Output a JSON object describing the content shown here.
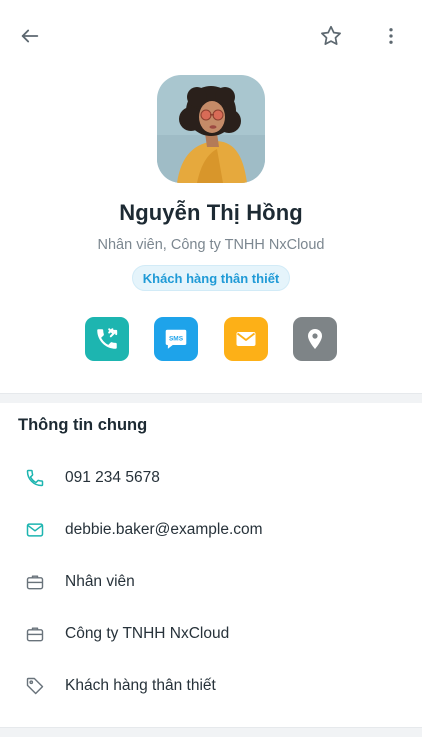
{
  "contact": {
    "name": "Nguyễn Thị Hồng",
    "subtitle": "Nhân viên, Công ty TNHH NxCloud",
    "badge": "Khách hàng thân thiết"
  },
  "actions": [
    {
      "icon": "phone-call-icon",
      "color": "#1db5b0"
    },
    {
      "icon": "sms-icon",
      "label": "SMS",
      "color": "#1ea3ea"
    },
    {
      "icon": "mail-icon",
      "color": "#fdb017"
    },
    {
      "icon": "location-pin-icon",
      "color": "#7e8487"
    }
  ],
  "general_info": {
    "title": "Thông tin chung",
    "rows": [
      {
        "icon": "phone-icon",
        "text": "091 234 5678"
      },
      {
        "icon": "mail-icon",
        "text": "debbie.baker@example.com"
      },
      {
        "icon": "briefcase-icon",
        "text": "Nhân viên"
      },
      {
        "icon": "briefcase-icon",
        "text": "Công ty TNHH NxCloud"
      },
      {
        "icon": "tag-icon",
        "text": "Khách hàng thân thiết"
      }
    ]
  },
  "colors": {
    "accent": "#1db5b0",
    "badge_text": "#1f9ad6"
  }
}
